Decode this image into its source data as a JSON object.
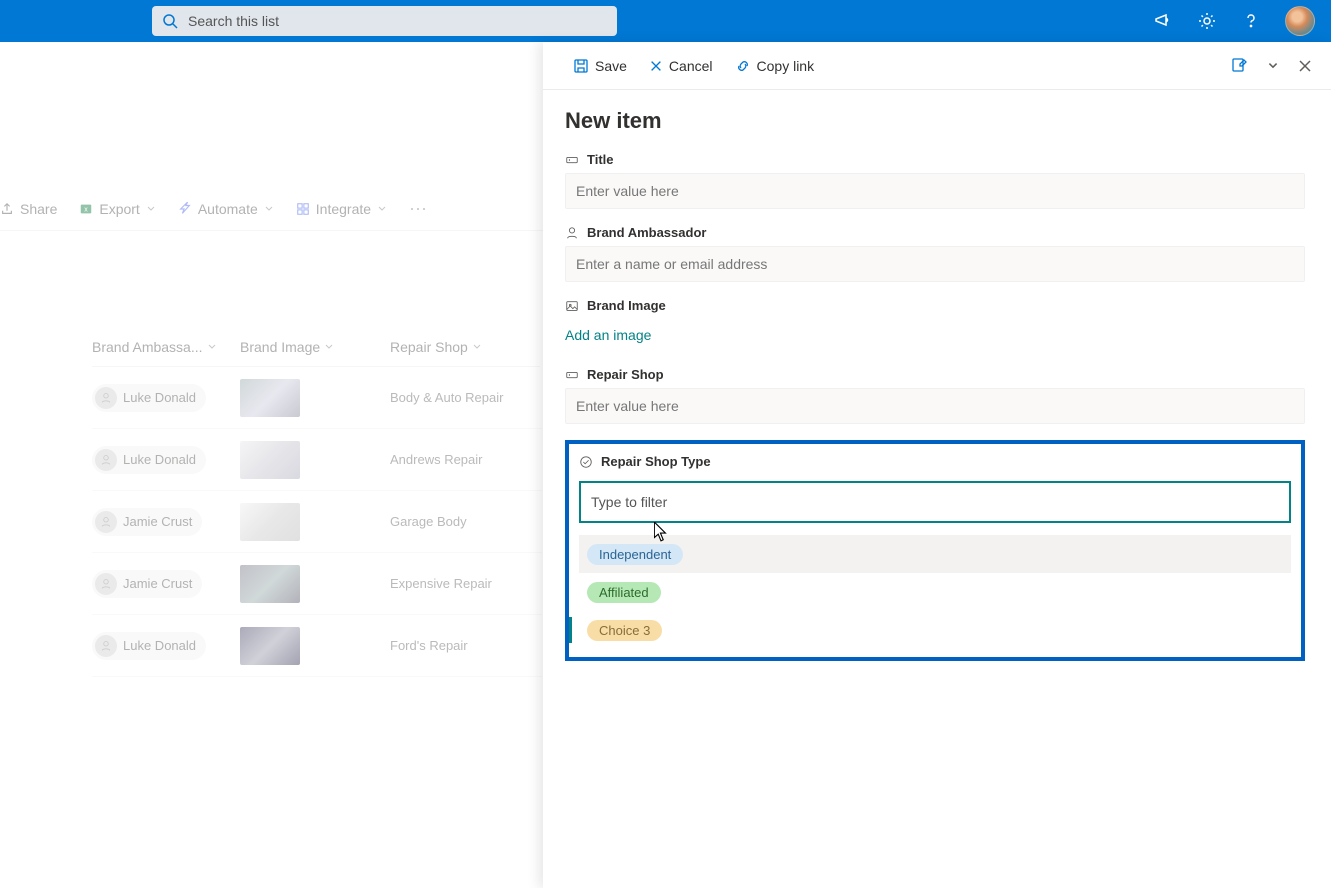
{
  "search": {
    "placeholder": "Search this list"
  },
  "commandBar": {
    "share": "Share",
    "export": "Export",
    "automate": "Automate",
    "integrate": "Integrate"
  },
  "columns": {
    "brandAmbassador": "Brand Ambassa...",
    "brandImage": "Brand Image",
    "repairShop": "Repair Shop"
  },
  "rows": [
    {
      "person": "Luke Donald",
      "repair": "Body & Auto Repair"
    },
    {
      "person": "Luke Donald",
      "repair": "Andrews Repair"
    },
    {
      "person": "Jamie Crust",
      "repair": "Garage Body"
    },
    {
      "person": "Jamie Crust",
      "repair": "Expensive Repair"
    },
    {
      "person": "Luke Donald",
      "repair": "Ford's Repair"
    }
  ],
  "panel": {
    "toolbar": {
      "save": "Save",
      "cancel": "Cancel",
      "copyLink": "Copy link"
    },
    "title": "New item",
    "fields": {
      "titleLabel": "Title",
      "titlePlaceholder": "Enter value here",
      "brandAmbassadorLabel": "Brand Ambassador",
      "brandAmbassadorPlaceholder": "Enter a name or email address",
      "brandImageLabel": "Brand Image",
      "addImage": "Add an image",
      "repairShopLabel": "Repair Shop",
      "repairShopPlaceholder": "Enter value here",
      "repairShopTypeLabel": "Repair Shop Type",
      "filterPlaceholder": "Type to filter"
    },
    "choices": {
      "0": "Independent",
      "1": "Affiliated",
      "2": "Choice 3"
    }
  }
}
